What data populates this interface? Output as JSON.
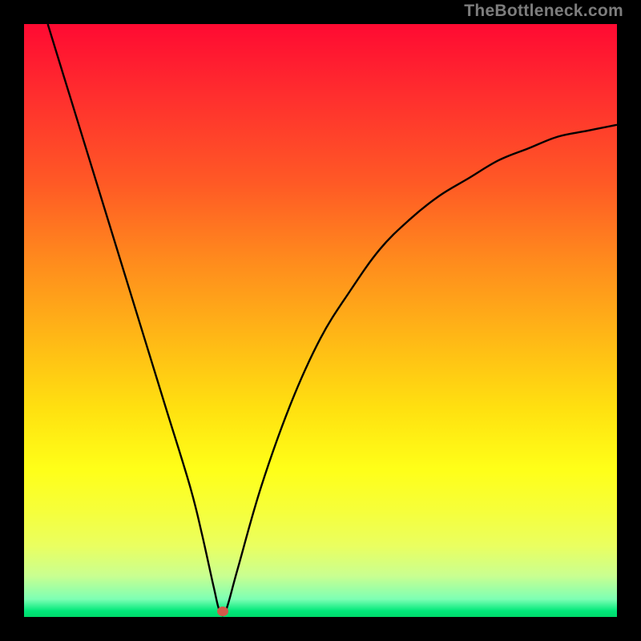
{
  "watermark": "TheBottleneck.com",
  "chart_data": {
    "type": "line",
    "title": "",
    "xlabel": "",
    "ylabel": "",
    "xlim": [
      0,
      100
    ],
    "ylim": [
      0,
      100
    ],
    "grid": false,
    "series": [
      {
        "name": "bottleneck-curve",
        "x": [
          4,
          8,
          12,
          16,
          20,
          24,
          28,
          30,
          32,
          33,
          34,
          36,
          40,
          45,
          50,
          55,
          60,
          65,
          70,
          75,
          80,
          85,
          90,
          95,
          100
        ],
        "y": [
          100,
          87,
          74,
          61,
          48,
          35,
          22,
          14,
          5,
          1,
          1,
          8,
          22,
          36,
          47,
          55,
          62,
          67,
          71,
          74,
          77,
          79,
          81,
          82,
          83
        ]
      }
    ],
    "marker": {
      "x": 33.5,
      "y": 1
    },
    "colors": {
      "curve": "#000000",
      "marker": "#d35a4a",
      "background_top": "#ff0a32",
      "background_bottom": "#00d96a"
    }
  }
}
